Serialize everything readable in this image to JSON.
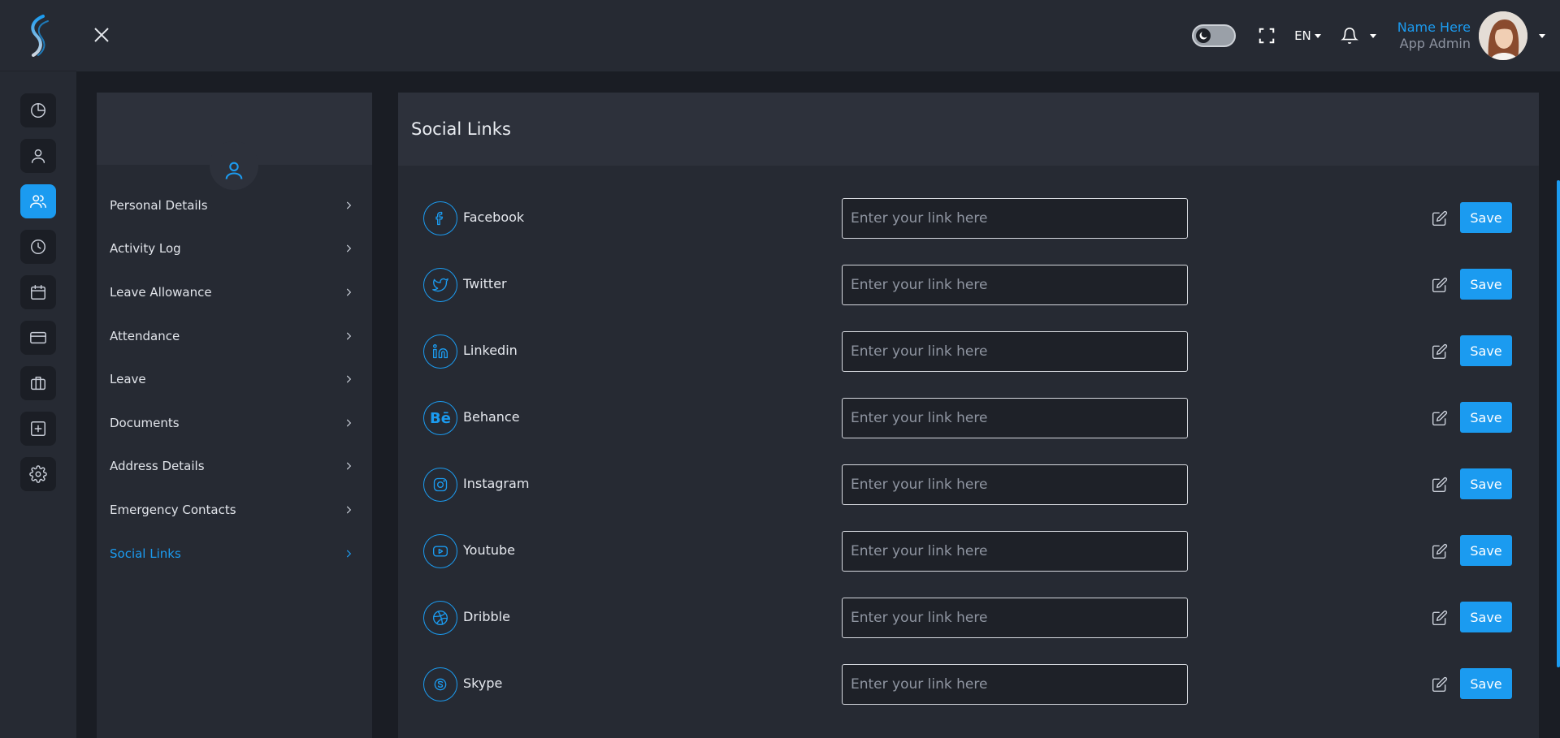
{
  "brand": {
    "logo_icon": "s-wave-logo"
  },
  "rail": {
    "items": [
      {
        "icon": "pie-chart-icon",
        "active": false
      },
      {
        "icon": "user-icon",
        "active": false
      },
      {
        "icon": "users-icon",
        "active": true
      },
      {
        "icon": "clock-icon",
        "active": false
      },
      {
        "icon": "calendar-icon",
        "active": false
      },
      {
        "icon": "credit-card-icon",
        "active": false
      },
      {
        "icon": "briefcase-icon",
        "active": false
      },
      {
        "icon": "plus-square-icon",
        "active": false
      },
      {
        "icon": "gear-icon",
        "active": false
      }
    ]
  },
  "topbar": {
    "language": "EN",
    "user_name": "Name Here",
    "user_role": "App Admin",
    "theme_toggle_on": true
  },
  "profile_nav": {
    "items": [
      {
        "label": "Personal Details"
      },
      {
        "label": "Activity Log"
      },
      {
        "label": "Leave Allowance"
      },
      {
        "label": "Attendance"
      },
      {
        "label": "Leave"
      },
      {
        "label": "Documents"
      },
      {
        "label": "Address Details"
      },
      {
        "label": "Emergency Contacts"
      },
      {
        "label": "Social Links"
      }
    ],
    "active_index": 8
  },
  "social": {
    "title": "Social Links",
    "placeholder": "Enter your link here",
    "save_label": "Save",
    "rows": [
      {
        "label": "Facebook",
        "icon": "facebook-icon"
      },
      {
        "label": "Twitter",
        "icon": "twitter-icon"
      },
      {
        "label": "Linkedin",
        "icon": "linkedin-icon"
      },
      {
        "label": "Behance",
        "icon": "behance-icon"
      },
      {
        "label": "Instagram",
        "icon": "instagram-icon"
      },
      {
        "label": "Youtube",
        "icon": "youtube-icon"
      },
      {
        "label": "Dribble",
        "icon": "dribbble-icon"
      },
      {
        "label": "Skype",
        "icon": "skype-icon"
      }
    ]
  },
  "colors": {
    "accent": "#1b9bf0",
    "panel": "#262a33",
    "panel_header": "#2d313b",
    "background": "#1a1d24"
  }
}
